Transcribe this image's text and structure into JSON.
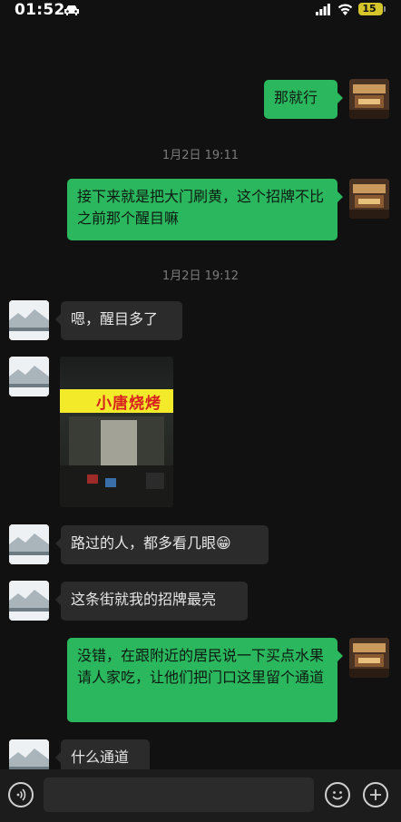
{
  "status_bar": {
    "time": "01:52",
    "battery": "15"
  },
  "messages": [
    {
      "sender": "me",
      "text": "那就行"
    },
    {
      "type": "timestamp",
      "text": "1月2日 19:11"
    },
    {
      "sender": "me",
      "text": "接下来就是把大门刷黄，这个招牌不比之前那个醒目嘛"
    },
    {
      "type": "timestamp",
      "text": "1月2日 19:12"
    },
    {
      "sender": "other",
      "text": "嗯，醒目多了"
    },
    {
      "sender": "other",
      "type": "image",
      "sign_text": "小唐烧烤"
    },
    {
      "sender": "other",
      "text": "路过的人，都多看几眼😁"
    },
    {
      "sender": "other",
      "text": "这条街就我的招牌最亮"
    },
    {
      "sender": "me",
      "text": "没错，在跟附近的居民说一下买点水果请人家吃，让他们把门口这里留个通道"
    },
    {
      "sender": "other",
      "text": "什么通道"
    }
  ],
  "icons": {
    "status": [
      "car-icon",
      "signal-icon",
      "wifi-icon",
      "battery-icon"
    ],
    "input_bar": [
      "voice-icon",
      "emoji-icon",
      "plus-icon"
    ]
  },
  "colors": {
    "bubble_me": "#2bb75e",
    "bubble_other": "#2b2b2b",
    "background": "#111111"
  }
}
